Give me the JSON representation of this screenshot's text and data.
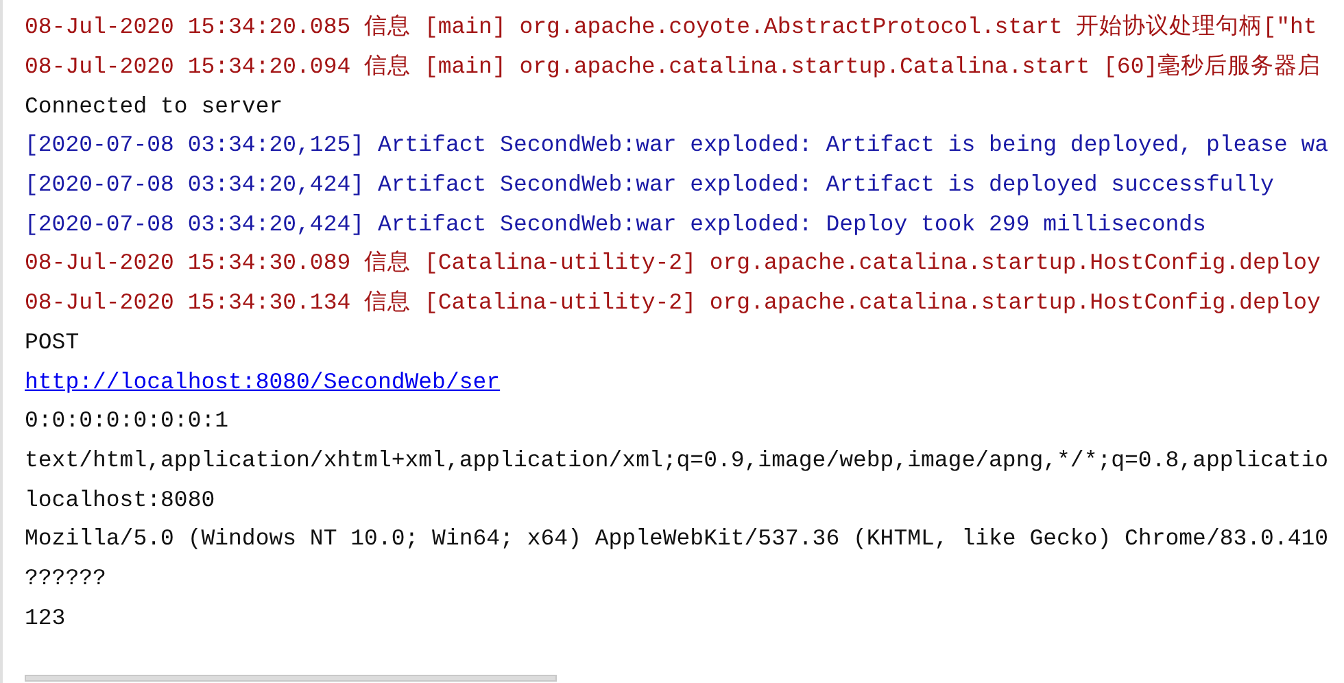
{
  "console_lines": [
    {
      "kind": "log",
      "text": "08-Jul-2020 15:34:20.085 信息 [main] org.apache.coyote.AbstractProtocol.start 开始协议处理句柄[\"ht"
    },
    {
      "kind": "log",
      "text": "08-Jul-2020 15:34:20.094 信息 [main] org.apache.catalina.startup.Catalina.start [60]毫秒后服务器启"
    },
    {
      "kind": "stdout",
      "text": "Connected to server"
    },
    {
      "kind": "ide",
      "text": "[2020-07-08 03:34:20,125] Artifact SecondWeb:war exploded: Artifact is being deployed, please wa"
    },
    {
      "kind": "ide",
      "text": "[2020-07-08 03:34:20,424] Artifact SecondWeb:war exploded: Artifact is deployed successfully"
    },
    {
      "kind": "ide",
      "text": "[2020-07-08 03:34:20,424] Artifact SecondWeb:war exploded: Deploy took 299 milliseconds"
    },
    {
      "kind": "log",
      "text": "08-Jul-2020 15:34:30.089 信息 [Catalina-utility-2] org.apache.catalina.startup.HostConfig.deploy"
    },
    {
      "kind": "log",
      "text": "08-Jul-2020 15:34:30.134 信息 [Catalina-utility-2] org.apache.catalina.startup.HostConfig.deploy"
    },
    {
      "kind": "stdout",
      "text": "POST"
    },
    {
      "kind": "link",
      "text": "http://localhost:8080/SecondWeb/ser"
    },
    {
      "kind": "stdout",
      "text": "0:0:0:0:0:0:0:1"
    },
    {
      "kind": "stdout",
      "text": "text/html,application/xhtml+xml,application/xml;q=0.9,image/webp,image/apng,*/*;q=0.8,applicatio"
    },
    {
      "kind": "stdout",
      "text": "localhost:8080"
    },
    {
      "kind": "stdout",
      "text": "Mozilla/5.0 (Windows NT 10.0; Win64; x64) AppleWebKit/537.36 (KHTML, like Gecko) Chrome/83.0.410"
    },
    {
      "kind": "stdout",
      "text": "??????"
    },
    {
      "kind": "stdout",
      "text": "123"
    }
  ]
}
